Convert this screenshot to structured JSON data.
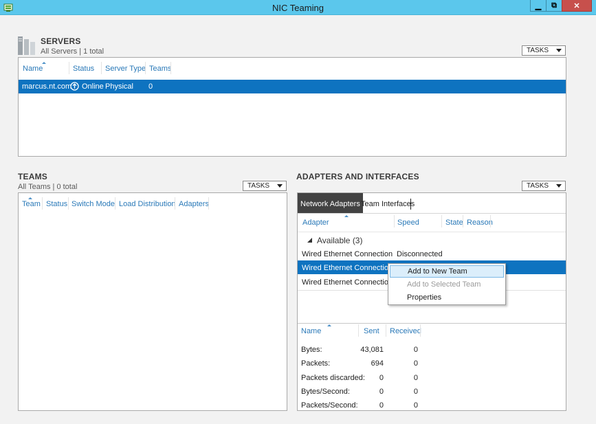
{
  "window": {
    "title": "NIC Teaming",
    "minimize": "▁",
    "restore": "⧉",
    "close": "✕"
  },
  "servers": {
    "title": "SERVERS",
    "subtitle": "All Servers | 1 total",
    "tasks": "TASKS",
    "headers": [
      "Name",
      "Status",
      "Server Type",
      "Teams"
    ],
    "row": {
      "name": "marcus.nt.com",
      "status": "Online",
      "type": "Physical",
      "teams": "0"
    }
  },
  "teams": {
    "title": "TEAMS",
    "subtitle": "All Teams | 0 total",
    "tasks": "TASKS",
    "headers": [
      "Team",
      "Status",
      "Switch Mode",
      "Load Distribution",
      "Adapters"
    ]
  },
  "adapters": {
    "title": "ADAPTERS AND INTERFACES",
    "tasks": "TASKS",
    "tabs": [
      "Network Adapters",
      "Team Interfaces"
    ],
    "headers": [
      "Adapter",
      "Speed",
      "State",
      "Reason"
    ],
    "group": "Available (3)",
    "rows": [
      {
        "adapter": "Wired Ethernet Connection",
        "speed": "Disconnected"
      },
      {
        "adapter": "Wired Ethernet Connection",
        "speed": ""
      },
      {
        "adapter": "Wired Ethernet Connection",
        "speed": ""
      }
    ],
    "context_menu": [
      "Add to New Team",
      "Add to Selected Team",
      "Properties"
    ],
    "stats": {
      "headers": [
        "Name",
        "Sent",
        "Received"
      ],
      "rows": [
        {
          "name": "Bytes:",
          "sent": "43,081",
          "received": "0"
        },
        {
          "name": "Packets:",
          "sent": "694",
          "received": "0"
        },
        {
          "name": "Packets discarded:",
          "sent": "0",
          "received": "0"
        },
        {
          "name": "Bytes/Second:",
          "sent": "0",
          "received": "0"
        },
        {
          "name": "Packets/Second:",
          "sent": "0",
          "received": "0"
        }
      ]
    }
  },
  "colors": {
    "titlebar": "#5bc7ec",
    "selection": "#0e73c0",
    "header_text": "#2a79b8"
  }
}
